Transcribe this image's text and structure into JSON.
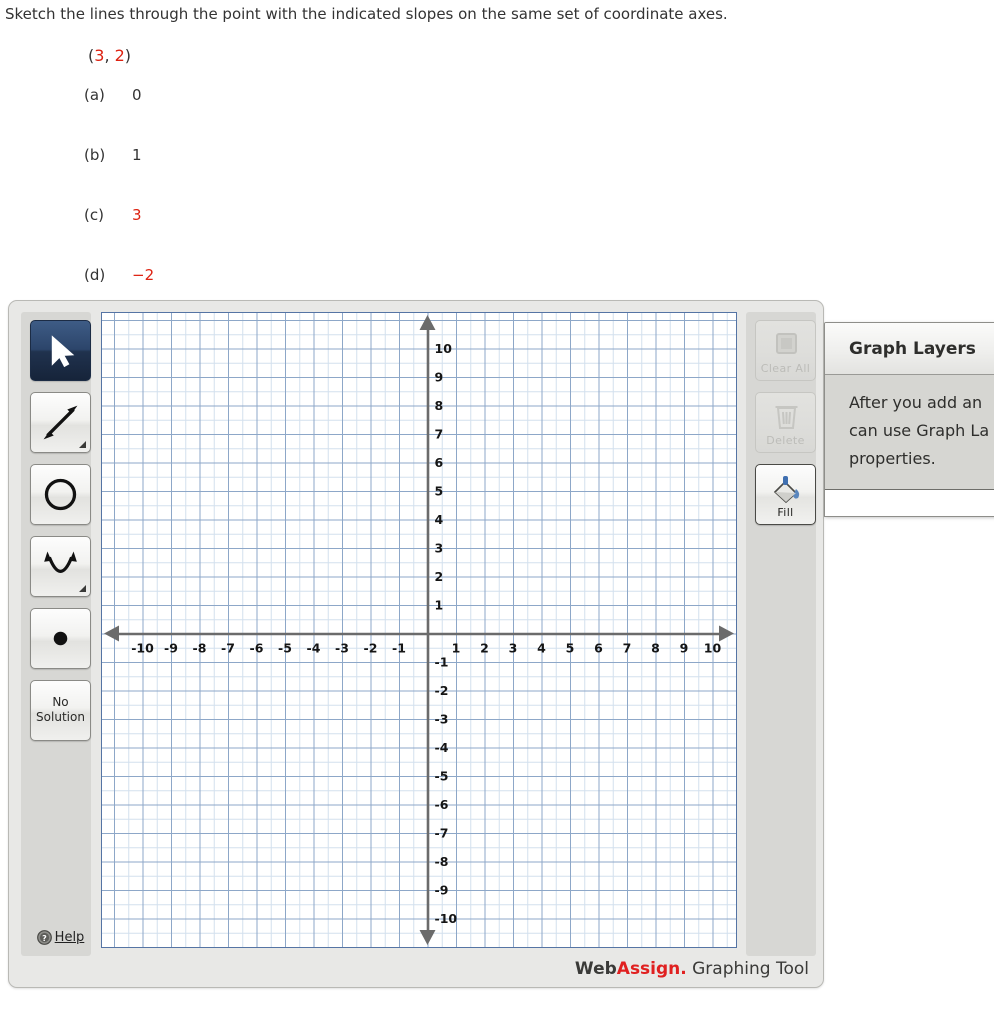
{
  "question": {
    "prompt": "Sketch the lines through the point with the indicated slopes on the same set of coordinate axes.",
    "point": {
      "open_paren": "(",
      "x": "3",
      "comma": ", ",
      "y": "2",
      "close_paren": ")"
    },
    "parts": [
      {
        "label": "(a)",
        "value": "0",
        "color": "dark"
      },
      {
        "label": "(b)",
        "value": "1",
        "color": "dark"
      },
      {
        "label": "(c)",
        "value": "3",
        "color": "red"
      },
      {
        "label": "(d)",
        "value": "−2",
        "color": "red"
      }
    ]
  },
  "left_toolbar": {
    "tools": [
      {
        "name": "select-tool",
        "icon": "cursor-arrow-icon",
        "selected": true,
        "flyout": false
      },
      {
        "name": "line-tool",
        "icon": "double-arrow-line-icon",
        "selected": false,
        "flyout": true
      },
      {
        "name": "circle-tool",
        "icon": "circle-icon",
        "selected": false,
        "flyout": false
      },
      {
        "name": "parabola-tool",
        "icon": "parabola-icon",
        "selected": false,
        "flyout": true
      },
      {
        "name": "point-tool",
        "icon": "filled-dot-icon",
        "selected": false,
        "flyout": false
      }
    ],
    "no_solution_label": "No\nSolution",
    "no_solution_line1": "No",
    "no_solution_line2": "Solution",
    "help_label": "Help",
    "help_icon": "question-mark-circle-icon"
  },
  "right_toolbar": {
    "buttons": [
      {
        "name": "clear-all-button",
        "label": "Clear All",
        "icon": "clear-square-icon",
        "enabled": false
      },
      {
        "name": "delete-button",
        "label": "Delete",
        "icon": "trash-can-icon",
        "enabled": false
      },
      {
        "name": "fill-button",
        "label": "Fill",
        "icon": "paint-bucket-icon",
        "enabled": true
      }
    ]
  },
  "graph_layers": {
    "title": "Graph Layers",
    "body_text": "After you add an object, you can use Graph Layers to view and edit properties.",
    "body_visible_lines": [
      "After you add an",
      "can use Graph La",
      "properties."
    ]
  },
  "brand": {
    "web": "Web",
    "assign": "Assign.",
    "tool": " Graphing Tool"
  },
  "colors": {
    "red_accent": "#dd2211",
    "brand_red": "#e02020",
    "grid_major": "#8da7c8",
    "grid_minor": "#d3e0ee",
    "axis": "#6b6b6b",
    "canvas_border": "#5574a4",
    "panel_bg": "#e8e8e6",
    "toolbar_bg": "#d7d7d4",
    "selected_tool": "#24395c"
  },
  "chart_data": {
    "type": "scatter",
    "title": "",
    "xlabel": "",
    "ylabel": "",
    "xlim": [
      -11,
      11
    ],
    "ylim": [
      -11,
      11
    ],
    "grid": true,
    "legend": "none",
    "x_ticks": [
      -10,
      -9,
      -8,
      -7,
      -6,
      -5,
      -4,
      -3,
      -2,
      -1,
      1,
      2,
      3,
      4,
      5,
      6,
      7,
      8,
      9,
      10
    ],
    "y_ticks": [
      10,
      9,
      8,
      7,
      6,
      5,
      4,
      3,
      2,
      1,
      -1,
      -2,
      -3,
      -4,
      -5,
      -6,
      -7,
      -8,
      -9,
      -10
    ],
    "x_tick_labels": [
      "-10",
      "-9",
      "-8",
      "-7",
      "-6",
      "-5",
      "-4",
      "-3",
      "-2",
      "-1",
      "1",
      "2",
      "3",
      "4",
      "5",
      "6",
      "7",
      "8",
      "9",
      "10"
    ],
    "y_tick_labels": [
      "10",
      "9",
      "8",
      "7",
      "6",
      "5",
      "4",
      "3",
      "2",
      "1",
      "-1",
      "-2",
      "-3",
      "-4",
      "-5",
      "-6",
      "-7",
      "-8",
      "-9",
      "-10"
    ],
    "minor_ticks_per_unit": 2,
    "series": [],
    "annotations": []
  }
}
